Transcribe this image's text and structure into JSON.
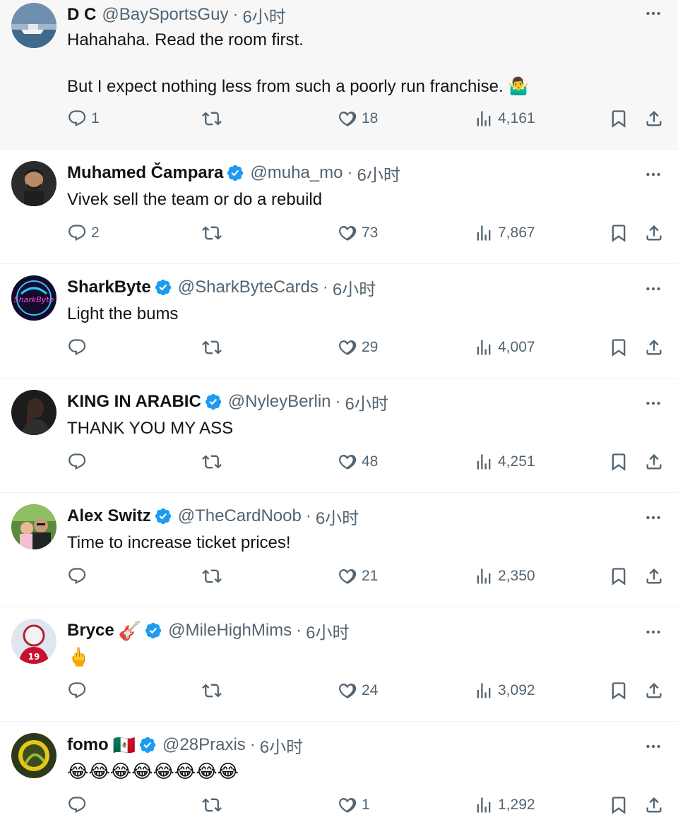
{
  "tweets": [
    {
      "name": "D C",
      "handle": "@BaySportsGuy",
      "sep": "·",
      "time": "6小时",
      "text": "Hahahaha.  Read the room first.\n\nBut I expect nothing less from such a poorly run franchise. 🤷‍♂️",
      "replies": "1",
      "retweets": "",
      "likes": "18",
      "views": "4,161",
      "verified": false,
      "extra": ""
    },
    {
      "name": "Muhamed Čampara",
      "handle": "@muha_mo",
      "sep": "·",
      "time": "6小时",
      "text": "Vivek sell the team or do a rebuild",
      "replies": "2",
      "retweets": "",
      "likes": "73",
      "views": "7,867",
      "verified": true,
      "extra": ""
    },
    {
      "name": "SharkByte",
      "handle": "@SharkByteCards",
      "sep": "·",
      "time": "6小时",
      "text": "Light the bums",
      "replies": "",
      "retweets": "",
      "likes": "29",
      "views": "4,007",
      "verified": true,
      "extra": ""
    },
    {
      "name": "KING IN ARABIC",
      "handle": "@NyleyBerlin",
      "sep": "·",
      "time": "6小时",
      "text": "THANK YOU MY ASS",
      "replies": "",
      "retweets": "",
      "likes": "48",
      "views": "4,251",
      "verified": true,
      "extra": ""
    },
    {
      "name": "Alex Switz",
      "handle": "@TheCardNoob",
      "sep": "·",
      "time": "6小时",
      "text": "Time to increase ticket prices!",
      "replies": "",
      "retweets": "",
      "likes": "21",
      "views": "2,350",
      "verified": true,
      "extra": ""
    },
    {
      "name": "Bryce",
      "handle": "@MileHighMims",
      "sep": "·",
      "time": "6小时",
      "text": "🖕",
      "replies": "",
      "retweets": "",
      "likes": "24",
      "views": "3,092",
      "verified": true,
      "extra": "🎸"
    },
    {
      "name": "fomo",
      "handle": "@28Praxis",
      "sep": "·",
      "time": "6小时",
      "text": "😂😂😂😂😂😂😂😂",
      "replies": "",
      "retweets": "",
      "likes": "1",
      "views": "1,292",
      "verified": true,
      "extra": "🇲🇽"
    }
  ],
  "icons": {
    "reply": "reply-icon",
    "retweet": "retweet-icon",
    "like": "heart-icon",
    "views": "views-icon",
    "bookmark": "bookmark-icon",
    "share": "share-icon",
    "more": "more-icon",
    "verified": "verified-badge-icon"
  },
  "colors": {
    "verified": "#1d9bf0",
    "muted": "#536471",
    "text": "#0f1419"
  }
}
